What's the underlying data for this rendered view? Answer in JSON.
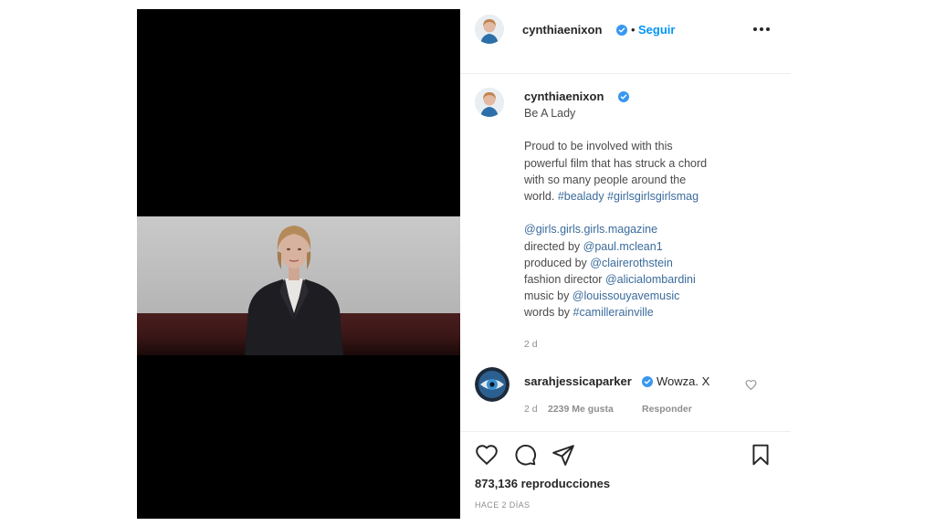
{
  "post": {
    "author": "cynthiaenixon",
    "follow_label": "Seguir",
    "separator": "•",
    "caption": {
      "author": "cynthiaenixon",
      "title": "Be A Lady",
      "body_lines": [
        "Proud to be involved with this",
        "powerful film that has struck a chord",
        "with so many people around the",
        "world."
      ],
      "hashtag1": "#bealady",
      "hashtag2": "#girlsgirlsgirlsmag",
      "credits": [
        {
          "prefix": "",
          "tag": "@girls.girls.girls.magazine"
        },
        {
          "prefix": "directed by ",
          "tag": "@paul.mclean1"
        },
        {
          "prefix": "produced by ",
          "tag": "@clairerothstein"
        },
        {
          "prefix": "fashion director ",
          "tag": "@alicialombardini"
        },
        {
          "prefix": "music by ",
          "tag": "@louissouyavemusic"
        },
        {
          "prefix": "words by ",
          "tag": "#camillerainville"
        }
      ],
      "time": "2 d"
    },
    "comment": {
      "author": "sarahjessicaparker",
      "text": "Wowza. X",
      "time": "2 d",
      "likes": "2239 Me gusta",
      "reply_label": "Responder"
    },
    "views": "873,136 reproducciones",
    "posted_ago": "HACE 2 DÍAS"
  },
  "icons": {
    "verified": "verified-badge-icon",
    "more": "more-options-icon",
    "like": "heart-icon",
    "comment": "comment-icon",
    "share": "share-icon",
    "save": "bookmark-icon",
    "comment_like": "small-heart-icon"
  },
  "colors": {
    "verified_blue": "#3897f0",
    "follow_blue": "#0095f6",
    "text": "#262626",
    "muted": "#8e8e8e",
    "link": "#3b6b9c"
  }
}
